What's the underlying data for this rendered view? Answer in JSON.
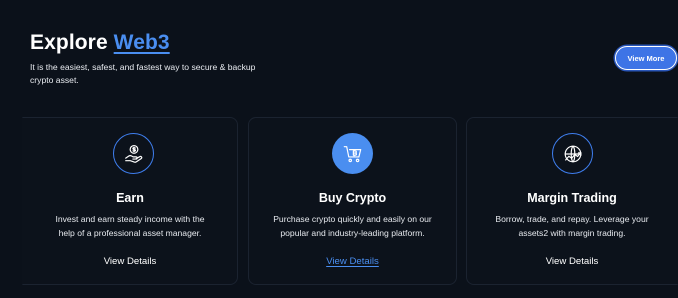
{
  "hero": {
    "title_prefix": "Explore ",
    "title_accent": "Web3",
    "description": "It is the easiest, safest, and fastest way to secure & backup crypto asset.",
    "view_more_label": "View More"
  },
  "cards": [
    {
      "icon": "hand-dollar-icon",
      "title": "Earn",
      "description": "Invest and earn steady income with the help of a professional asset manager.",
      "link_label": "View Details"
    },
    {
      "icon": "cart-bitcoin-icon",
      "title": "Buy Crypto",
      "description": "Purchase crypto quickly and easily on our popular and industry-leading platform.",
      "link_label": "View Details"
    },
    {
      "icon": "globe-chart-icon",
      "title": "Margin Trading",
      "description": "Borrow, trade, and repay. Leverage your assets2 with margin trading.",
      "link_label": "View Details"
    }
  ],
  "colors": {
    "background": "#0b111a",
    "accent": "#4a8ef0",
    "card_border": "#1b2330"
  }
}
